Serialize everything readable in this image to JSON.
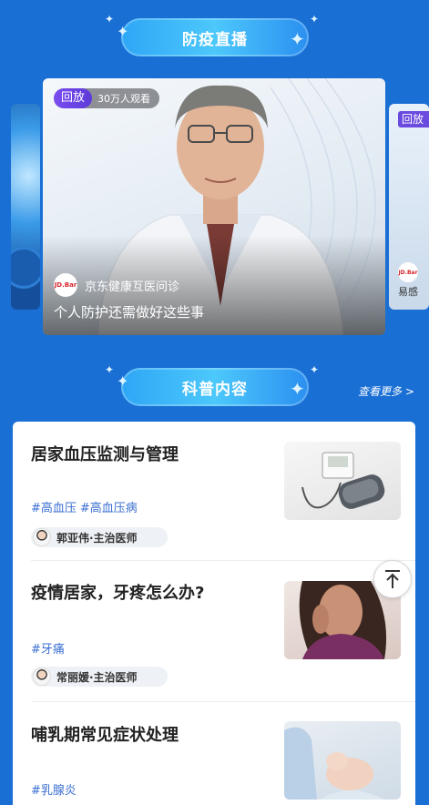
{
  "live_section": {
    "title": "防疫直播"
  },
  "featured_video": {
    "badge": "回放",
    "viewers": "30万人观看",
    "source_logo": "JD.Bar",
    "source_name": "京东健康互医问诊",
    "title": "个人防护还需做好这些事"
  },
  "side_video_right": {
    "badge": "回放",
    "logo": "JD.Bar",
    "text": "易感"
  },
  "science_section": {
    "title": "科普内容",
    "see_more": "查看更多 >"
  },
  "articles": [
    {
      "title": "居家血压监测与管理",
      "tags": [
        "#高血压",
        "#高血压病"
      ],
      "doctor": "郭亚伟·主治医师",
      "thumb": "blood-pressure-monitor"
    },
    {
      "title": "疫情居家，牙疼怎么办?",
      "tags": [
        "#牙痛"
      ],
      "doctor": "常丽媛·主治医师",
      "thumb": "woman-toothache"
    },
    {
      "title": "哺乳期常见症状处理",
      "tags": [
        "#乳腺炎"
      ],
      "doctor": "",
      "thumb": "breastfeeding"
    }
  ],
  "colors": {
    "background": "#1a6fd4",
    "accent_purple": "#6b4ae0",
    "tag_blue": "#3b6fd0"
  }
}
